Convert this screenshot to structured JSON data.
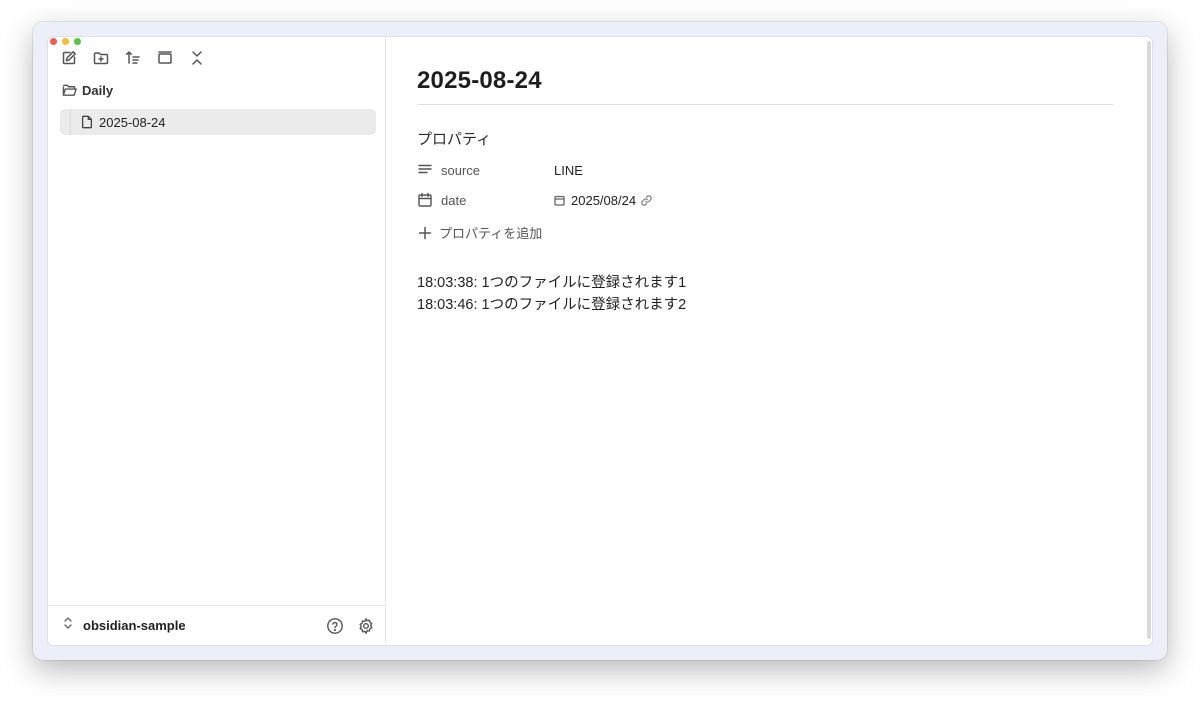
{
  "sidebar": {
    "toolbar": [
      {
        "name": "new-note-icon"
      },
      {
        "name": "new-folder-icon"
      },
      {
        "name": "sort-icon"
      },
      {
        "name": "auto-reveal-icon"
      },
      {
        "name": "collapse-all-icon"
      }
    ],
    "folder_label": "Daily",
    "file_label": "2025-08-24",
    "vault_name": "obsidian-sample"
  },
  "editor": {
    "title": "2025-08-24",
    "properties_heading": "プロパティ",
    "properties": [
      {
        "key": "source",
        "value": "LINE",
        "icon": "text-lines-icon"
      },
      {
        "key": "date",
        "value": "2025/08/24",
        "icon": "calendar-icon"
      }
    ],
    "add_property_label": "プロパティを追加",
    "body_lines": [
      "18:03:38: 1つのファイルに登録されます1",
      "18:03:46: 1つのファイルに登録されます2"
    ]
  },
  "colors": {
    "selected_file_bg": "#ebebeb",
    "close": "#ee5b52",
    "minimize": "#f3bd2f",
    "zoom": "#5ac440"
  }
}
